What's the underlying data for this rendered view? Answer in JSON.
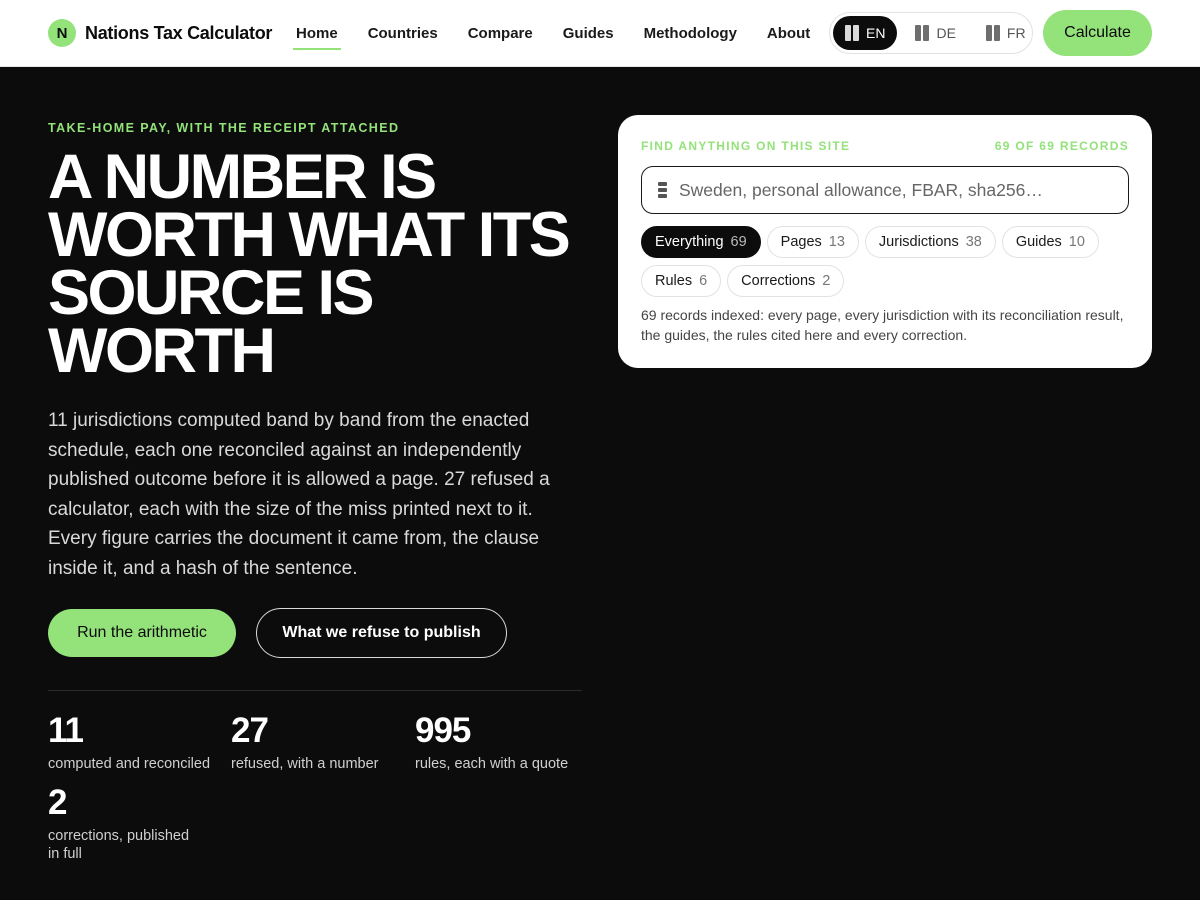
{
  "header": {
    "brand_initial": "N",
    "brand_name": "Nations Tax Calculator",
    "nav": [
      {
        "label": "Home",
        "active": true
      },
      {
        "label": "Countries"
      },
      {
        "label": "Compare"
      },
      {
        "label": "Guides"
      },
      {
        "label": "Methodology"
      },
      {
        "label": "About"
      }
    ],
    "languages": [
      {
        "code": "EN",
        "active": true
      },
      {
        "code": "DE"
      },
      {
        "code": "FR"
      }
    ],
    "cta_label": "Calculate"
  },
  "hero": {
    "eyebrow": "TAKE-HOME PAY, WITH THE RECEIPT ATTACHED",
    "headline": "A NUMBER IS WORTH WHAT ITS SOURCE IS WORTH",
    "lede": "11 jurisdictions computed band by band from the enacted schedule, each one reconciled against an independently published outcome before it is allowed a page. 27 refused a calculator, each with the size of the miss printed next to it. Every figure carries the document it came from, the clause inside it, and a hash of the sentence.",
    "primary_button": "Run the arithmetic",
    "secondary_button": "What we refuse to publish"
  },
  "stats": [
    {
      "value": "11",
      "label": "computed and reconciled"
    },
    {
      "value": "27",
      "label": "refused, with a number"
    },
    {
      "value": "995",
      "label": "rules, each with a quote"
    },
    {
      "value": "2",
      "label": "corrections, published in full"
    }
  ],
  "search_card": {
    "eyebrow": "FIND ANYTHING ON THIS SITE",
    "count": "69 OF 69 RECORDS",
    "placeholder": "Sweden, personal allowance, FBAR, sha256…",
    "filters": [
      {
        "label": "Everything",
        "count": "69",
        "active": true
      },
      {
        "label": "Pages",
        "count": "13"
      },
      {
        "label": "Jurisdictions",
        "count": "38"
      },
      {
        "label": "Guides",
        "count": "10"
      },
      {
        "label": "Rules",
        "count": "6"
      },
      {
        "label": "Corrections",
        "count": "2"
      }
    ],
    "description": "69 records indexed: every page, every jurisdiction with its reconciliation result, the guides, the rules cited here and every correction."
  },
  "colors": {
    "accent": "#93e27a",
    "background": "#0c0c0c",
    "card": "#ffffff"
  }
}
